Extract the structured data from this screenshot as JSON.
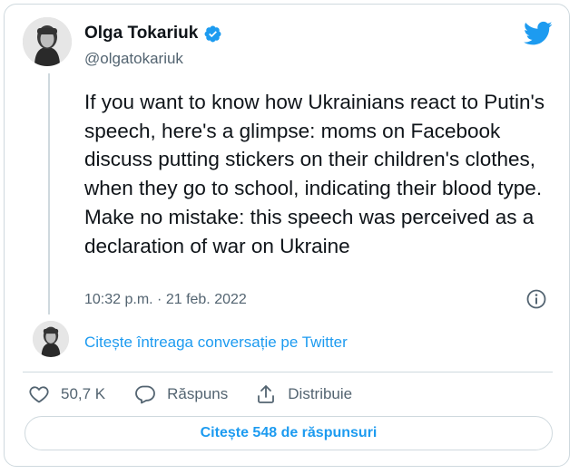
{
  "author": {
    "name": "Olga Tokariuk",
    "handle": "@olgatokariuk",
    "verified": true,
    "avatar_icon": "profile-photo"
  },
  "tweet": {
    "text": "If you want to know how Ukrainians react to Putin's speech, here's a glimpse: moms on Facebook discuss putting stickers on their children's clothes, when they go to school, indicating their blood type. Make no mistake: this speech was perceived as a declaration of war on Ukraine",
    "timestamp": "10:32 p.m. · 21 feb. 2022"
  },
  "conversation": {
    "link_text": "Citește întreaga conversație pe Twitter"
  },
  "actions": {
    "like_count": "50,7 K",
    "reply_label": "Răspuns",
    "share_label": "Distribuie"
  },
  "footer": {
    "read_replies_label": "Citește 548 de răspunsuri"
  },
  "colors": {
    "accent": "#1d9bf0",
    "text": "#0f1419",
    "muted": "#536471",
    "border": "#cfd9de"
  },
  "icons": [
    "twitter-bird-icon",
    "verified-badge-icon",
    "info-icon",
    "heart-icon",
    "reply-bubble-icon",
    "share-icon"
  ]
}
